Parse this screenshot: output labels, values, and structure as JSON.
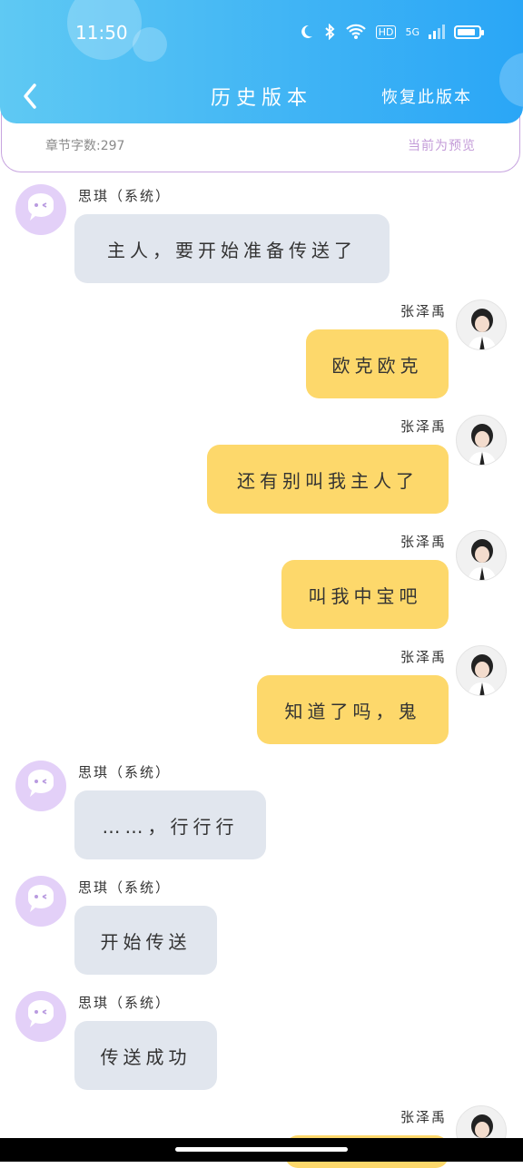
{
  "status_bar": {
    "time": "11:50",
    "hd": "HD",
    "network": "5G",
    "battery_level": 0.85
  },
  "header": {
    "title": "历史版本",
    "restore_label": "恢复此版本"
  },
  "info": {
    "word_count": "章节字数:297",
    "preview_label": "当前为预览"
  },
  "messages": [
    {
      "sender": "思琪（系统）",
      "role": "system",
      "text": "主人，要开始准备传送了"
    },
    {
      "sender": "张泽禹",
      "role": "user",
      "text": "欧克欧克"
    },
    {
      "sender": "张泽禹",
      "role": "user",
      "text": "还有别叫我主人了"
    },
    {
      "sender": "张泽禹",
      "role": "user",
      "text": "叫我中宝吧"
    },
    {
      "sender": "张泽禹",
      "role": "user",
      "text": "知道了吗，鬼"
    },
    {
      "sender": "思琪（系统）",
      "role": "system",
      "text": "……，行行行"
    },
    {
      "sender": "思琪（系统）",
      "role": "system",
      "text": "开始传送"
    },
    {
      "sender": "思琪（系统）",
      "role": "system",
      "text": "传送成功"
    },
    {
      "sender": "张泽禹",
      "role": "user",
      "text": ""
    }
  ],
  "colors": {
    "header": "#3eb3f5",
    "user_bubble": "#fdd86b",
    "system_bubble": "#e1e6ee",
    "system_avatar": "#e3d0f8",
    "accent_purple": "#c39bd8"
  }
}
